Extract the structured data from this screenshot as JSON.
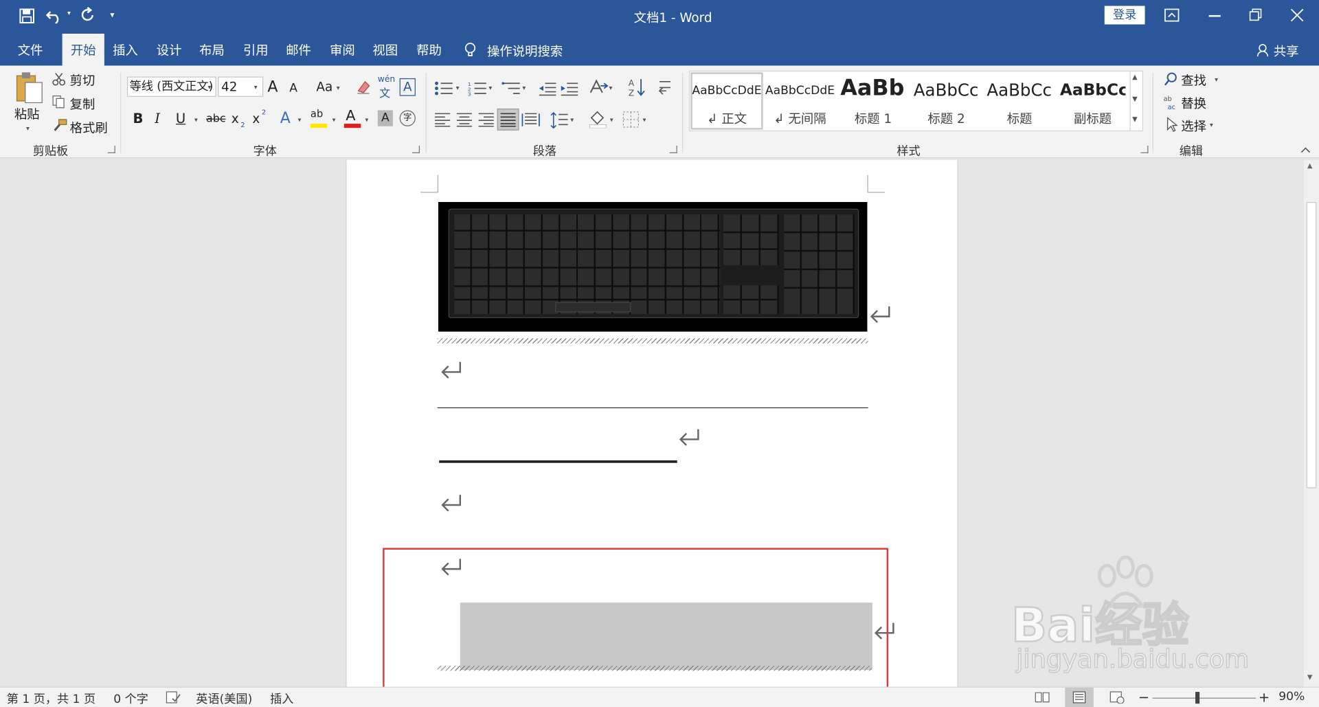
{
  "window": {
    "doc_title": "文档1  -  Word",
    "login_label": "登录"
  },
  "tabs": [
    {
      "label": "文件"
    },
    {
      "label": "开始"
    },
    {
      "label": "插入"
    },
    {
      "label": "设计"
    },
    {
      "label": "布局"
    },
    {
      "label": "引用"
    },
    {
      "label": "邮件"
    },
    {
      "label": "审阅"
    },
    {
      "label": "视图"
    },
    {
      "label": "帮助"
    }
  ],
  "tell_me": "操作说明搜索",
  "share_label": "共享",
  "clipboard": {
    "paste": "粘贴",
    "cut": "剪切",
    "copy": "复制",
    "format_painter": "格式刷",
    "group": "剪贴板"
  },
  "font": {
    "name": "等线 (西文正文)",
    "size": "42",
    "group": "字体",
    "grow": "A",
    "shrink": "A",
    "case": "Aa",
    "bold": "B",
    "italic": "I",
    "underline": "U",
    "strike": "abc",
    "sub": "x",
    "sup": "x",
    "phonetic": "wén",
    "phonetic2": "文",
    "border_char": "A",
    "effects": "A",
    "highlight": "ab",
    "font_color": "A",
    "shade": "A",
    "enclose": "字"
  },
  "paragraph": {
    "group": "段落"
  },
  "styles": {
    "group": "样式",
    "items": [
      {
        "preview": "AaBbCcDdE",
        "name": "正文"
      },
      {
        "preview": "AaBbCcDdE",
        "name": "无间隔"
      },
      {
        "preview": "AaBb",
        "name": "标题 1"
      },
      {
        "preview": "AaBbCc",
        "name": "标题 2"
      },
      {
        "preview": "AaBbCc",
        "name": "标题"
      },
      {
        "preview": "AaBbCc",
        "name": "副标题"
      }
    ]
  },
  "editing": {
    "find": "查找",
    "replace": "替换",
    "select": "选择",
    "group": "编辑"
  },
  "status": {
    "page": "第 1 页，共 1 页",
    "words": "0 个字",
    "language": "英语(美国)",
    "mode": "插入",
    "zoom": "90%"
  },
  "watermark": {
    "brand": "Bai经验",
    "url": "jingyan.baidu.com"
  },
  "colors": {
    "accent": "#2b579a",
    "highlight_box": "#e03a3a",
    "gray_block": "#c8c8c8"
  }
}
